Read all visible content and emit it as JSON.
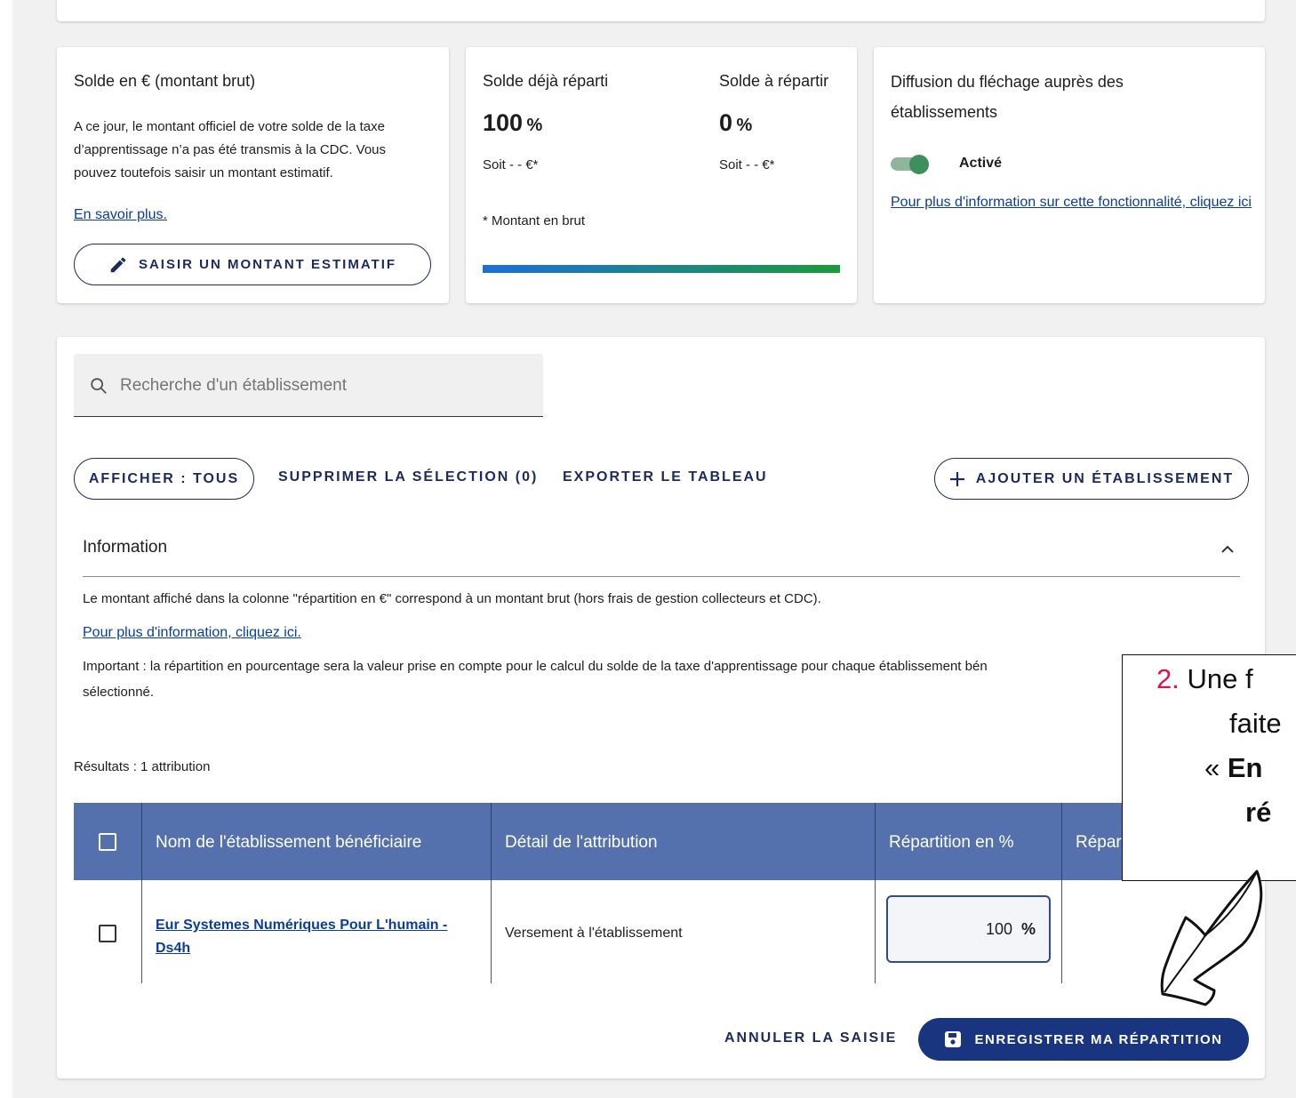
{
  "balance": {
    "title": "Solde en € (montant brut)",
    "text": "A ce jour, le montant officiel de votre solde de la taxe d’apprentissage n’a pas été transmis à la CDC. Vous pouvez toutefois saisir un montant estimatif.",
    "link": "En savoir plus.",
    "button": "SAISIR UN MONTANT ESTIMATIF"
  },
  "split": {
    "distributed_label": "Solde déjà réparti",
    "distributed_value": "100",
    "distributed_unit": "%",
    "distributed_amount": "Soit - - €*",
    "remaining_label": "Solde à répartir",
    "remaining_value": "0",
    "remaining_unit": "%",
    "remaining_amount": "Soit - - €*",
    "note": "* Montant en brut",
    "progress_fraction": 1.0
  },
  "diffusion": {
    "title": "Diffusion du fléchage auprès des établissements",
    "toggle_label": "Activé",
    "toggle_on": true,
    "link": "Pour plus d'information sur cette fonctionnalité, cliquez ici"
  },
  "search": {
    "placeholder": "Recherche d'un établissement"
  },
  "actions": {
    "filter": "AFFICHER : TOUS",
    "delete": "SUPPRIMER LA SÉLECTION (0)",
    "export": "EXPORTER LE TABLEAU",
    "add": "AJOUTER UN ÉTABLISSEMENT"
  },
  "info": {
    "title": "Information",
    "line1": "Le montant affiché dans la colonne \"répartition en €\" correspond à un montant brut (hors frais de gestion collecteurs et CDC).",
    "link": "Pour plus d'information, cliquez ici.",
    "line2": "Important : la répartition en pourcentage sera la valeur prise en compte pour le calcul du solde de la taxe d'apprentissage pour chaque établissement bén",
    "line3": "sélectionné."
  },
  "results": "Résultats : 1 attribution",
  "table": {
    "headers": [
      "Nom de l'établissement bénéficiaire",
      "Détail de l'attribution",
      "Répartition en %",
      "Répar"
    ],
    "rows": [
      {
        "name": "Eur Systemes Numériques Pour L'humain - Ds4h",
        "detail": "Versement à l'établissement",
        "percent": "100",
        "unit": "%",
        "euro": "€"
      }
    ]
  },
  "footer": {
    "cancel": "ANNULER LA SAISIE",
    "save": "ENREGISTRER MA RÉPARTITION"
  },
  "annotation": {
    "number": "2.",
    "line1": " Une f",
    "line2": "faite",
    "quote": "« ",
    "bold2": "En",
    "line3": "ré"
  },
  "colors": {
    "header_bg": "#5470ad",
    "brand_blue": "#1a2b5c",
    "progress_start": "#1c6fd9",
    "progress_end": "#1c9a3c",
    "toggle": "#3e8f5b",
    "annotation_number": "#e0124b"
  }
}
